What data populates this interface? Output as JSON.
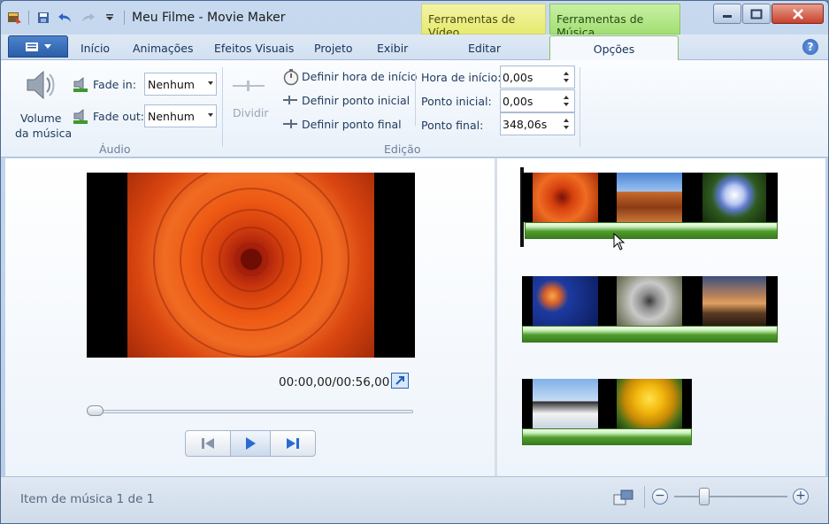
{
  "window": {
    "title": "Meu Filme - Movie Maker"
  },
  "context_tabs": {
    "video": "Ferramentas de Vídeo",
    "music": "Ferramentas de Música"
  },
  "tabs": [
    {
      "label": "Início"
    },
    {
      "label": "Animações"
    },
    {
      "label": "Efeitos Visuais"
    },
    {
      "label": "Projeto"
    },
    {
      "label": "Exibir"
    },
    {
      "label": "Editar"
    },
    {
      "label": "Opções"
    }
  ],
  "ribbon": {
    "audio": {
      "volume_label_1": "Volume",
      "volume_label_2": "da música",
      "fade_in_label": "Fade in:",
      "fade_in_value": "Nenhum",
      "fade_out_label": "Fade out:",
      "fade_out_value": "Nenhum",
      "group_label": "Áudio"
    },
    "edit": {
      "split_label": "Dividir",
      "set_start_time": "Definir hora de início",
      "set_start_point": "Definir ponto inicial",
      "set_end_point": "Definir ponto final",
      "start_time_label": "Hora de início:",
      "start_time_value": "0,00s",
      "start_point_label": "Ponto inicial:",
      "start_point_value": "0,00s",
      "end_point_label": "Ponto final:",
      "end_point_value": "348,06s",
      "group_label": "Edição"
    }
  },
  "preview": {
    "time": "00:00,00/00:56,00",
    "seek_fraction": 0.0
  },
  "storyboard": {
    "rows": [
      {
        "clips": [
          "chrysanthemum",
          "desert",
          "hydrangeas"
        ]
      },
      {
        "clips": [
          "jellyfish",
          "koala",
          "lighthouse"
        ]
      },
      {
        "clips": [
          "penguins",
          "tulips"
        ]
      }
    ]
  },
  "status": {
    "text": "Item de música 1 de 1",
    "zoom_fraction": 0.27
  },
  "colors": {
    "accent_blue": "#2b5ea8",
    "music_tab": "#a2df73",
    "video_tab": "#e6ea6e",
    "audio_track": "#4f9d2c"
  }
}
